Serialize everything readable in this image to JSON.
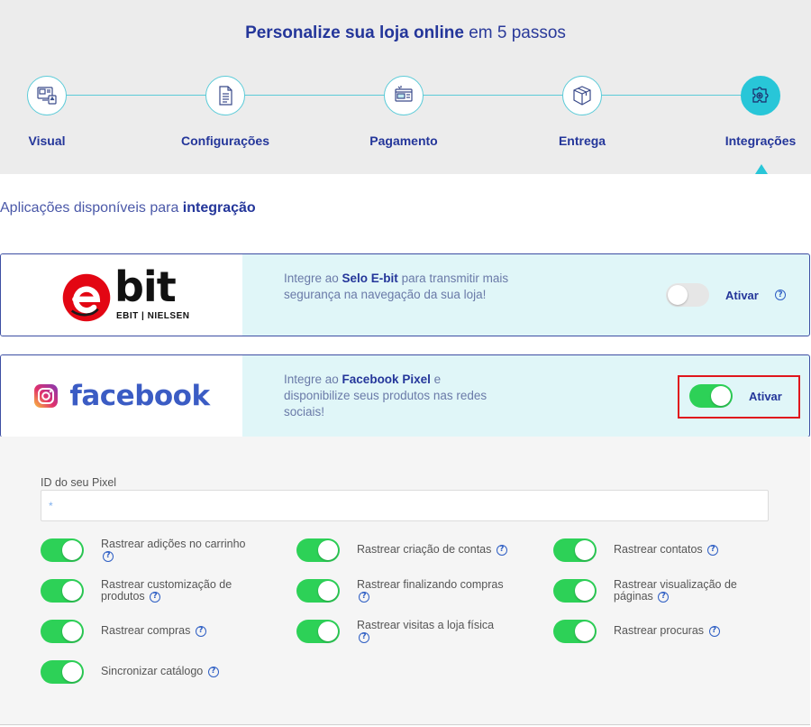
{
  "header": {
    "title_bold": "Personalize sua loja online",
    "title_rest": " em 5 passos",
    "steps": [
      {
        "label": "Visual",
        "icon": "visual-design-icon"
      },
      {
        "label": "Configurações",
        "icon": "document-icon"
      },
      {
        "label": "Pagamento",
        "icon": "payment-icon"
      },
      {
        "label": "Entrega",
        "icon": "package-box-icon"
      },
      {
        "label": "Integrações",
        "icon": "puzzle-gear-icon"
      }
    ],
    "active_step": 4
  },
  "section": {
    "title_prefix": "Aplicações disponíveis para ",
    "title_bold": "integração"
  },
  "integrations": [
    {
      "logo_text": "bit",
      "logo_sub": "EBIT | NIELSEN",
      "desc_prefix": "Integre ao ",
      "desc_bold": "Selo E-bit",
      "desc_suffix": " para transmitir mais segurança na navegação da sua loja!",
      "toggle_on": false,
      "activate_label": "Ativar"
    },
    {
      "logo_text": "facebook",
      "desc_prefix": "Integre ao ",
      "desc_bold": "Facebook Pixel",
      "desc_suffix": " e disponibilize seus produtos nas redes sociais!",
      "toggle_on": true,
      "activate_label": "Ativar"
    }
  ],
  "pixel": {
    "label": "ID do seu Pixel",
    "placeholder": "*",
    "value": ""
  },
  "options": [
    {
      "label": "Rastrear adições no carrinho",
      "on": true
    },
    {
      "label": "Rastrear criação de contas",
      "on": true
    },
    {
      "label": "Rastrear contatos",
      "on": true
    },
    {
      "label": "Rastrear customização de produtos",
      "on": true
    },
    {
      "label": "Rastrear finalizando compras",
      "on": true
    },
    {
      "label": "Rastrear visualização de páginas",
      "on": true
    },
    {
      "label": "Rastrear compras",
      "on": true
    },
    {
      "label": "Rastrear visitas a loja física",
      "on": true
    },
    {
      "label": "Rastrear procuras",
      "on": true
    },
    {
      "label": "Sincronizar catálogo",
      "on": true
    }
  ],
  "help_glyph": "?",
  "colors": {
    "brand_blue": "#24369a",
    "accent_cyan": "#28c6d8",
    "toggle_green": "#2dd157",
    "highlight_red": "#e0161d",
    "ebit_red": "#e30613"
  }
}
